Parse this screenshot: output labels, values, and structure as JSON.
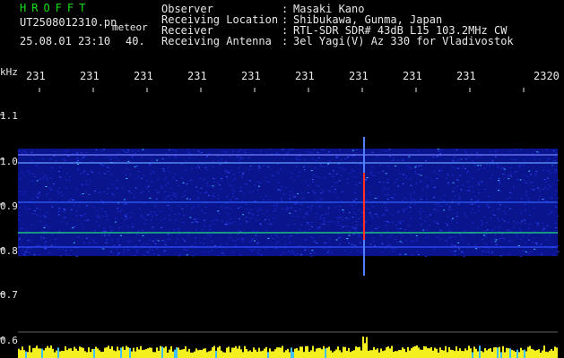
{
  "header": {
    "brand": "HROFFT",
    "filename": "UT2508012310.pn",
    "mode": "meteor",
    "datetime": "25.08.01 23:10",
    "count": "40.",
    "fields": [
      {
        "label": "Observer",
        "value": "Masaki Kano"
      },
      {
        "label": "Receiving Location",
        "value": "Shibukawa, Gunma, Japan"
      },
      {
        "label": "Receiver",
        "value": "RTL-SDR SDR# 43dB L15 103.2MHz CW"
      },
      {
        "label": "Receiving Antenna",
        "value": "3el Yagi(V) Az 330 for Vladivostok"
      }
    ],
    "colon": ":"
  },
  "axis": {
    "unit": "kHz",
    "time_ticks": [
      "231",
      "231",
      "231",
      "231",
      "231",
      "231",
      "231",
      "231",
      "231",
      "2320"
    ],
    "freq_ticks": [
      "1.1",
      "1.0",
      "0.9",
      "0.8",
      "0.7",
      "0.6"
    ]
  },
  "colors": {
    "background": "#000000",
    "noise_blue": "#1a2ad0",
    "band_green": "#20e080",
    "signal_red": "#ff3020",
    "amplitude_yellow": "#f4f020",
    "tick_white": "#e8e8e8"
  }
}
